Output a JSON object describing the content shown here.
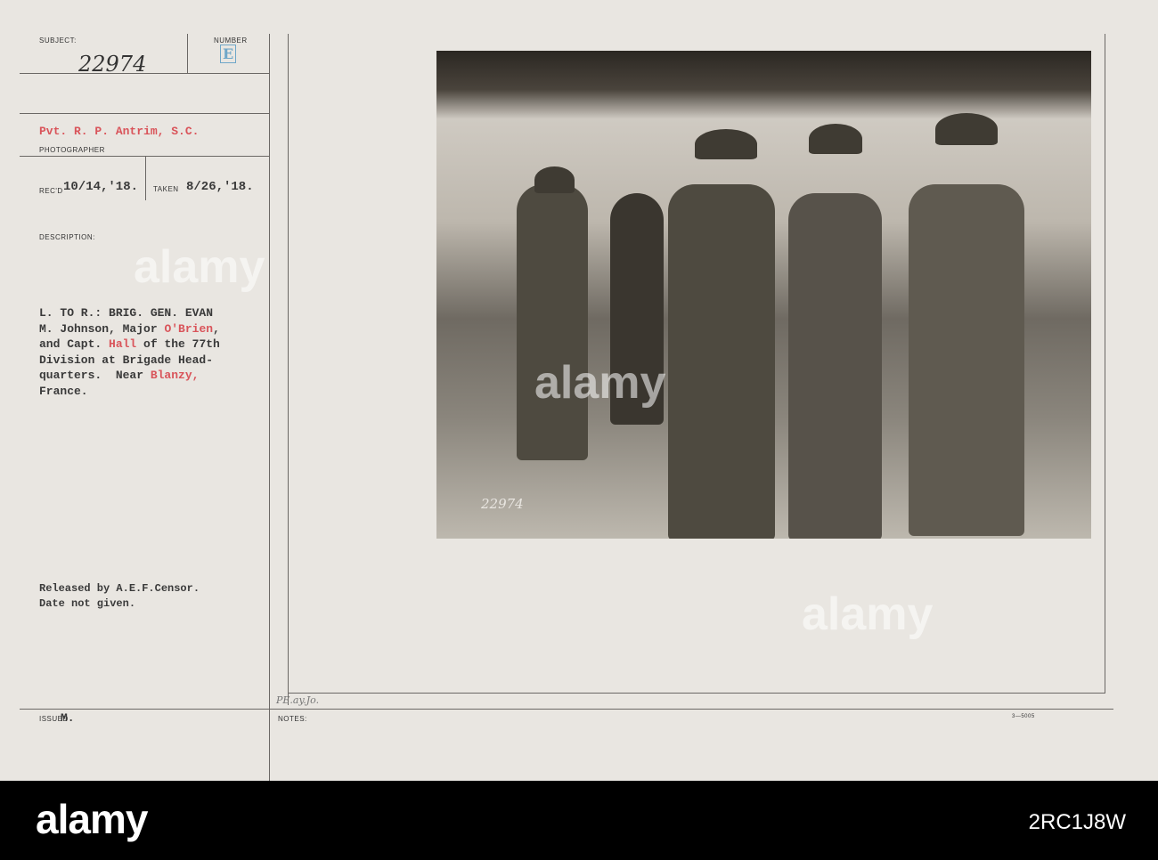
{
  "card": {
    "subject_label": "SUBJECT:",
    "subject_value": "22974",
    "number_label": "NUMBER",
    "number_value": "E",
    "photographer_value": "Pvt. R. P. Antrim, S.C.",
    "photographer_label": "PHOTOGRAPHER",
    "recd_label": "REC'D",
    "recd_value": "10/14,'18.",
    "taken_label": "TAKEN",
    "taken_value": "8/26,'18.",
    "description_label": "DESCRIPTION:",
    "description": {
      "l1": "L. TO R.: BRIG. GEN. EVAN",
      "l2a": "M. Johnson, Major ",
      "l2b": "O'Brien",
      "l2c": ",",
      "l3a": "and Capt. ",
      "l3b": "Hall",
      "l3c": " of the 77th",
      "l4": "Division at Brigade Head-",
      "l5a": "quarters.  Near ",
      "l5b": "Blanzy,",
      "l6": "France."
    },
    "release_l1": "Released by A.E.F.Censor.",
    "release_l2": "Date not given.",
    "issued_label": "ISSUED",
    "issued_value": "M.",
    "notes_label": "NOTES:",
    "pencil_note": "PE.ay.Jo.",
    "form_number": "3—5005",
    "photo_stamp": "22974"
  },
  "footer": {
    "logo": "alamy",
    "image_code": "2RC1J8W"
  },
  "watermark": "alamy"
}
